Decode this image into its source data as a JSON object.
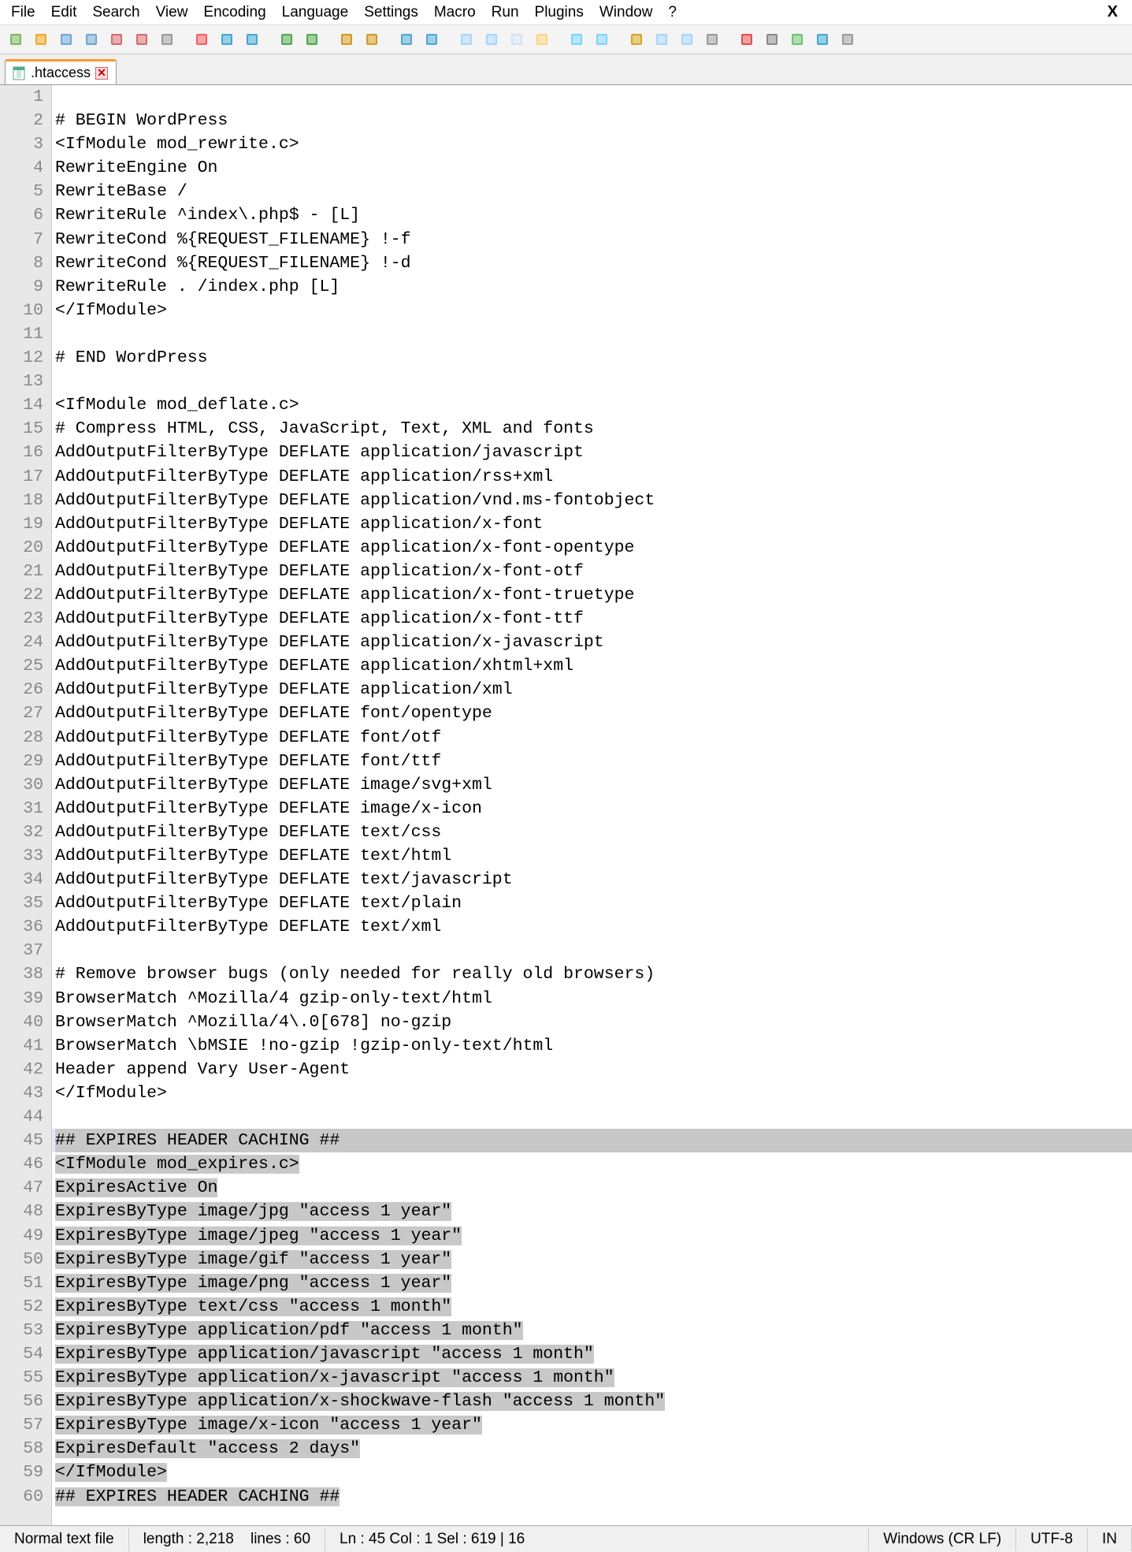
{
  "menu": [
    "File",
    "Edit",
    "Search",
    "View",
    "Encoding",
    "Language",
    "Settings",
    "Macro",
    "Run",
    "Plugins",
    "Window",
    "?"
  ],
  "close_label": "X",
  "tab": {
    "name": ".htaccess"
  },
  "toolbar_icons": [
    "new-file-icon",
    "open-file-icon",
    "save-icon",
    "save-all-icon",
    "close-icon",
    "close-all-icon",
    "print-icon",
    "cut-icon",
    "copy-icon",
    "paste-icon",
    "undo-icon",
    "redo-icon",
    "find-icon",
    "replace-icon",
    "zoom-in-icon",
    "zoom-out-icon",
    "sync-v-icon",
    "sync-h-icon",
    "wrap-icon",
    "show-all-icon",
    "indent-guide-icon",
    "highlight-icon",
    "folder-icon",
    "doc-map-icon",
    "func-list-icon",
    "monitor-icon",
    "record-icon",
    "stop-icon",
    "play-icon",
    "play-multi-icon",
    "save-macro-icon"
  ],
  "lines": [
    "",
    "# BEGIN WordPress",
    "<IfModule mod_rewrite.c>",
    "RewriteEngine On",
    "RewriteBase /",
    "RewriteRule ^index\\.php$ - [L]",
    "RewriteCond %{REQUEST_FILENAME} !-f",
    "RewriteCond %{REQUEST_FILENAME} !-d",
    "RewriteRule . /index.php [L]",
    "</IfModule>",
    "",
    "# END WordPress",
    "",
    "<IfModule mod_deflate.c>",
    "# Compress HTML, CSS, JavaScript, Text, XML and fonts",
    "AddOutputFilterByType DEFLATE application/javascript",
    "AddOutputFilterByType DEFLATE application/rss+xml",
    "AddOutputFilterByType DEFLATE application/vnd.ms-fontobject",
    "AddOutputFilterByType DEFLATE application/x-font",
    "AddOutputFilterByType DEFLATE application/x-font-opentype",
    "AddOutputFilterByType DEFLATE application/x-font-otf",
    "AddOutputFilterByType DEFLATE application/x-font-truetype",
    "AddOutputFilterByType DEFLATE application/x-font-ttf",
    "AddOutputFilterByType DEFLATE application/x-javascript",
    "AddOutputFilterByType DEFLATE application/xhtml+xml",
    "AddOutputFilterByType DEFLATE application/xml",
    "AddOutputFilterByType DEFLATE font/opentype",
    "AddOutputFilterByType DEFLATE font/otf",
    "AddOutputFilterByType DEFLATE font/ttf",
    "AddOutputFilterByType DEFLATE image/svg+xml",
    "AddOutputFilterByType DEFLATE image/x-icon",
    "AddOutputFilterByType DEFLATE text/css",
    "AddOutputFilterByType DEFLATE text/html",
    "AddOutputFilterByType DEFLATE text/javascript",
    "AddOutputFilterByType DEFLATE text/plain",
    "AddOutputFilterByType DEFLATE text/xml",
    "",
    "# Remove browser bugs (only needed for really old browsers)",
    "BrowserMatch ^Mozilla/4 gzip-only-text/html",
    "BrowserMatch ^Mozilla/4\\.0[678] no-gzip",
    "BrowserMatch \\bMSIE !no-gzip !gzip-only-text/html",
    "Header append Vary User-Agent",
    "</IfModule>",
    "",
    "## EXPIRES HEADER CACHING ##",
    "<IfModule mod_expires.c>",
    "ExpiresActive On",
    "ExpiresByType image/jpg \"access 1 year\"",
    "ExpiresByType image/jpeg \"access 1 year\"",
    "ExpiresByType image/gif \"access 1 year\"",
    "ExpiresByType image/png \"access 1 year\"",
    "ExpiresByType text/css \"access 1 month\"",
    "ExpiresByType application/pdf \"access 1 month\"",
    "ExpiresByType application/javascript \"access 1 month\"",
    "ExpiresByType application/x-javascript \"access 1 month\"",
    "ExpiresByType application/x-shockwave-flash \"access 1 month\"",
    "ExpiresByType image/x-icon \"access 1 year\"",
    "ExpiresDefault \"access 2 days\"",
    "</IfModule>",
    "## EXPIRES HEADER CACHING ##"
  ],
  "current_line": 45,
  "selection_start": 45,
  "selection_end": 60,
  "status": {
    "filetype": "Normal text file",
    "length_label": "length : 2,218",
    "lines_label": "lines : 60",
    "pos_label": "Ln : 45    Col : 1    Sel : 619 | 16",
    "eol": "Windows (CR LF)",
    "encoding": "UTF-8",
    "ins": "IN"
  }
}
